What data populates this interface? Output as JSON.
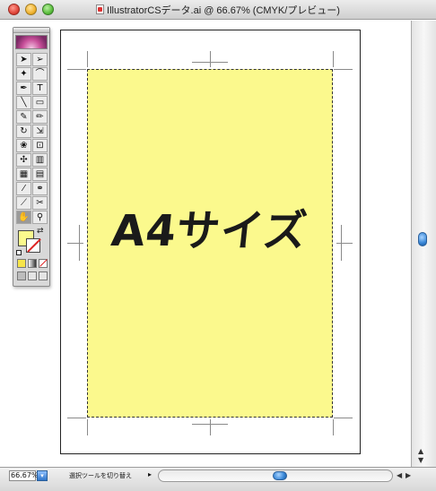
{
  "window": {
    "title": "IllustratorCSデータ.ai @ 66.67% (CMYK/プレビュー)"
  },
  "document": {
    "headline": "A4サイズ",
    "page_fill_color": "#fbf98d"
  },
  "tools_palette": {
    "tools": [
      {
        "name": "selection-tool-icon",
        "glyph": "➤"
      },
      {
        "name": "direct-selection-tool-icon",
        "glyph": "➢"
      },
      {
        "name": "magic-wand-tool-icon",
        "glyph": "✦"
      },
      {
        "name": "lasso-tool-icon",
        "glyph": "⌒"
      },
      {
        "name": "pen-tool-icon",
        "glyph": "✒"
      },
      {
        "name": "type-tool-icon",
        "glyph": "T"
      },
      {
        "name": "line-tool-icon",
        "glyph": "╲"
      },
      {
        "name": "rectangle-tool-icon",
        "glyph": "▭"
      },
      {
        "name": "paintbrush-tool-icon",
        "glyph": "✎"
      },
      {
        "name": "pencil-tool-icon",
        "glyph": "✏"
      },
      {
        "name": "rotate-tool-icon",
        "glyph": "↻"
      },
      {
        "name": "scale-tool-icon",
        "glyph": "⇲"
      },
      {
        "name": "warp-tool-icon",
        "glyph": "❀"
      },
      {
        "name": "free-transform-tool-icon",
        "glyph": "⊡"
      },
      {
        "name": "symbol-sprayer-tool-icon",
        "glyph": "✣"
      },
      {
        "name": "column-graph-tool-icon",
        "glyph": "▥"
      },
      {
        "name": "mesh-tool-icon",
        "glyph": "▦"
      },
      {
        "name": "gradient-tool-icon",
        "glyph": "▤"
      },
      {
        "name": "eyedropper-tool-icon",
        "glyph": "⁄"
      },
      {
        "name": "blend-tool-icon",
        "glyph": "⚭"
      },
      {
        "name": "slice-tool-icon",
        "glyph": "⟋"
      },
      {
        "name": "scissors-tool-icon",
        "glyph": "✂"
      },
      {
        "name": "hand-tool-icon",
        "glyph": "✋"
      },
      {
        "name": "zoom-tool-icon",
        "glyph": "⚲"
      }
    ],
    "fill_color": "#fbf98d",
    "stroke_color": "#ffffff"
  },
  "status_bar": {
    "zoom": "66.67%",
    "status_text": "選択ツールを切り替え"
  }
}
